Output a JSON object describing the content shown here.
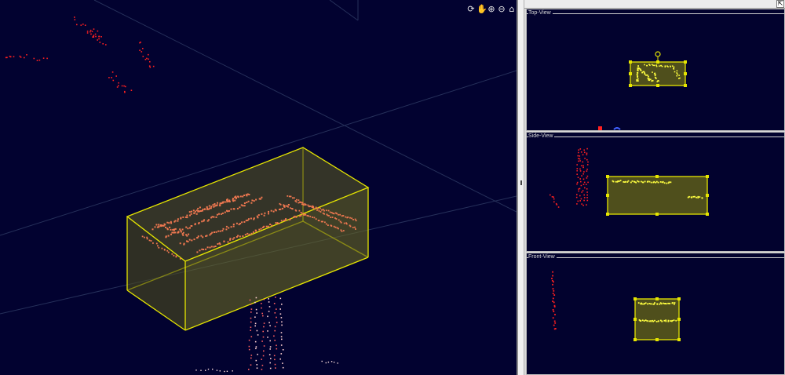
{
  "toolbar": {
    "icons": [
      "rotate-icon",
      "pan-hand-icon",
      "zoom-in-icon",
      "zoom-out-icon",
      "home-icon"
    ],
    "glyphs": [
      "⟳",
      "✋",
      "⊕",
      "⊖",
      "⌂"
    ]
  },
  "side_panel": {
    "expand_glyph": "⇱",
    "views": [
      {
        "title": "Top-View"
      },
      {
        "title": "Side-View"
      },
      {
        "title": "Front-View"
      }
    ]
  },
  "colors": {
    "background": "#020230",
    "cuboid_edge": "#e6e600",
    "cuboid_fill": "#6b6b1e",
    "points_inside": "#f07850",
    "points_outside": "#ff2020",
    "view_points": "#ffff40"
  }
}
